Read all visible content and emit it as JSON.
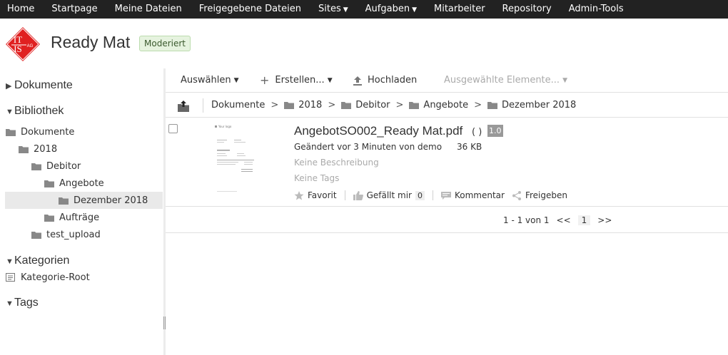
{
  "nav": {
    "items": [
      {
        "label": "Home",
        "dropdown": false
      },
      {
        "label": "Startpage",
        "dropdown": false
      },
      {
        "label": "Meine Dateien",
        "dropdown": false
      },
      {
        "label": "Freigegebene Dateien",
        "dropdown": false
      },
      {
        "label": "Sites",
        "dropdown": true
      },
      {
        "label": "Aufgaben",
        "dropdown": true
      },
      {
        "label": "Mitarbeiter",
        "dropdown": false
      },
      {
        "label": "Repository",
        "dropdown": false
      },
      {
        "label": "Admin-Tools",
        "dropdown": false
      }
    ]
  },
  "header": {
    "logo_text_top": "IT",
    "logo_text_bottom": "IS",
    "logo_text_small": "AG",
    "site_title": "Ready Mat",
    "badge": "Moderiert"
  },
  "sidebar": {
    "sections": {
      "dokumente": "Dokumente",
      "bibliothek": "Bibliothek",
      "kategorien": "Kategorien",
      "tags": "Tags"
    },
    "tree": {
      "dokumente": "Dokumente",
      "year": "2018",
      "debitor": "Debitor",
      "angebote": "Angebote",
      "dezember": "Dezember 2018",
      "auftraege": "Aufträge",
      "test_upload": "test_upload"
    },
    "category_root": "Kategorie-Root"
  },
  "toolbar": {
    "select": "Auswählen",
    "create": "Erstellen...",
    "upload": "Hochladen",
    "selected_items": "Ausgewählte Elemente..."
  },
  "breadcrumb": {
    "items": [
      "Dokumente",
      "2018",
      "Debitor",
      "Angebote",
      "Dezember 2018"
    ],
    "separator": ">"
  },
  "document": {
    "thumb_logo": "Your logo",
    "name": "AngebotSO002_Ready Mat.pdf",
    "parens": "( )",
    "version": "1.0",
    "modified": "Geändert vor 3 Minuten von demo",
    "size": "36 KB",
    "description": "Keine Beschreibung",
    "tags": "Keine Tags",
    "actions": {
      "favorite": "Favorit",
      "like": "Gefällt mir",
      "like_count": "0",
      "comment": "Kommentar",
      "share": "Freigeben"
    }
  },
  "pager": {
    "summary": "1 - 1 von 1",
    "prev": "<<",
    "current": "1",
    "next": ">>"
  },
  "colors": {
    "nav_bg": "#222222",
    "logo_red": "#e02020",
    "badge_bg": "#e6f3df",
    "selected_bg": "#e9e9e9",
    "version_bg": "#999999"
  }
}
